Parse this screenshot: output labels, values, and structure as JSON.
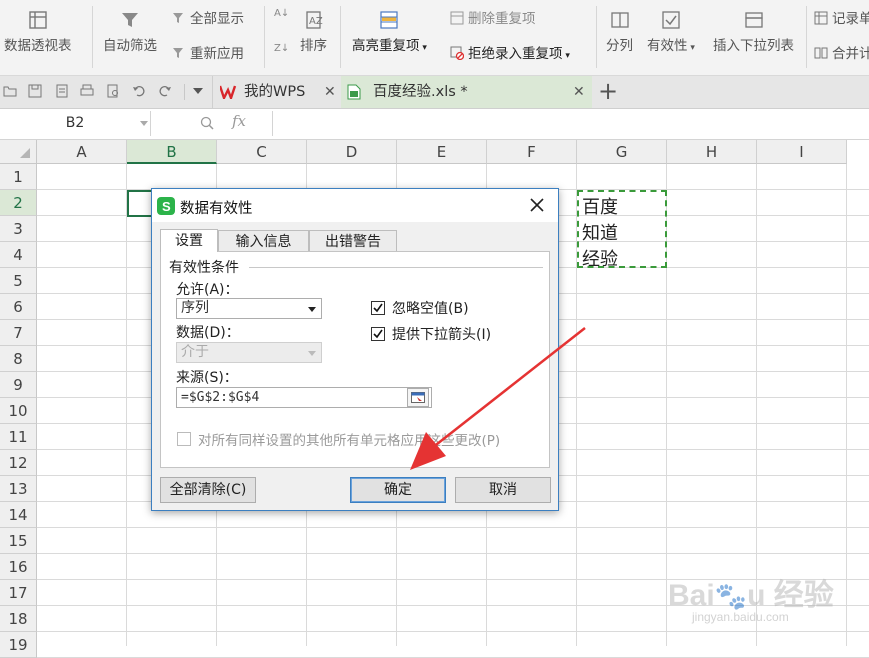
{
  "ribbon": {
    "pivot_label": "数据透视表",
    "autofilter_label": "自动筛选",
    "show_all_label": "全部显示",
    "reapply_label": "重新应用",
    "sort_label": "排序",
    "highlight_dup_label": "高亮重复项",
    "delete_dup_label": "删除重复项",
    "reject_dup_label": "拒绝录入重复项",
    "split_label": "分列",
    "validity_label": "有效性",
    "insert_dropdown_label": "插入下拉列表",
    "record_label": "记录单",
    "merge_calc_label": "合并计"
  },
  "tabs": {
    "wps_label": "我的WPS",
    "doc_label": "百度经验.xls *"
  },
  "formula_bar": {
    "name_box": "B2",
    "fx": "fx"
  },
  "grid": {
    "columns": [
      "A",
      "B",
      "C",
      "D",
      "E",
      "F",
      "G",
      "H",
      "I"
    ],
    "rows": [
      "1",
      "2",
      "3",
      "4",
      "5",
      "6",
      "7",
      "8",
      "9",
      "10",
      "11",
      "12",
      "13",
      "14",
      "15",
      "16",
      "17",
      "18",
      "19"
    ],
    "g_values": [
      "百度",
      "知道",
      "经验"
    ]
  },
  "dialog": {
    "title": "数据有效性",
    "tabs": [
      "设置",
      "输入信息",
      "出错警告"
    ],
    "section_title": "有效性条件",
    "allow_label": "允许(A)：",
    "allow_value": "序列",
    "ignore_blank_label": "忽略空值(B)",
    "dropdown_label": "提供下拉箭头(I)",
    "data_label": "数据(D)：",
    "data_value": "介于",
    "source_label": "来源(S)：",
    "source_value": "=$G$2:$G$4",
    "apply_all_label": "对所有同样设置的其他所有单元格应用这些更改(P)",
    "clear_all_label": "全部清除(C)",
    "ok_label": "确定",
    "cancel_label": "取消"
  },
  "colors": {
    "accent": "#217346",
    "tab_active": "#dbe8d6",
    "arrow": "#e53333",
    "title_icon": "#2cb34a"
  }
}
